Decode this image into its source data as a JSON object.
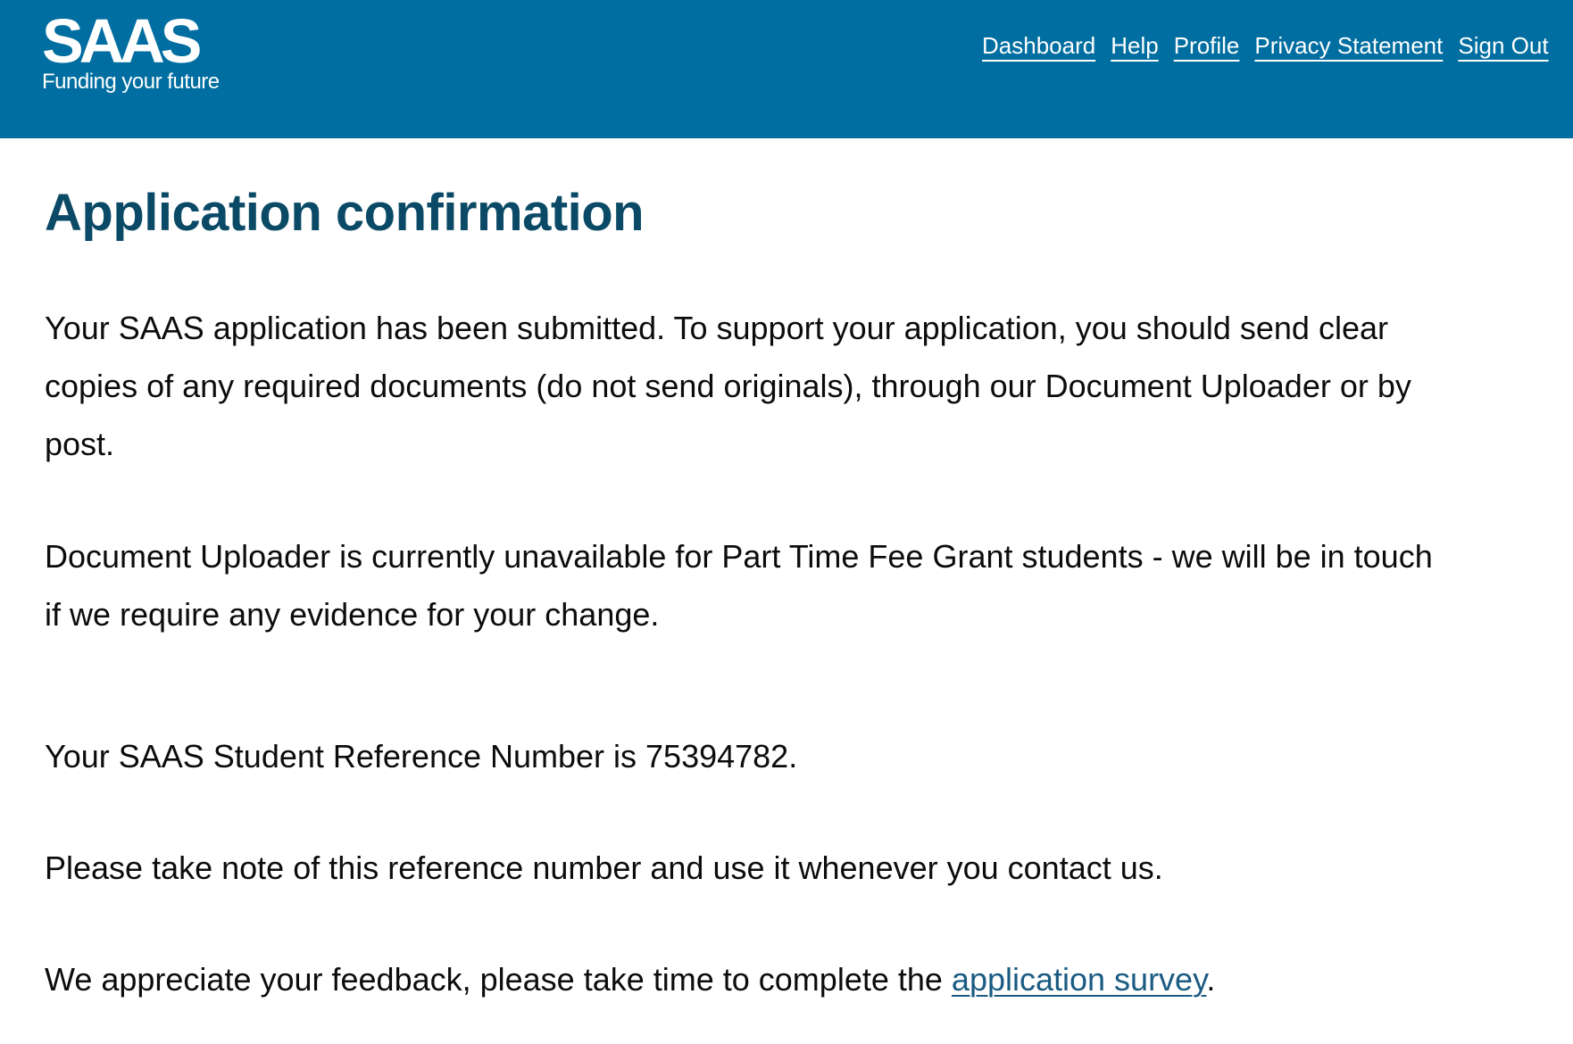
{
  "header": {
    "logo_text": "SAAS",
    "logo_tagline": "Funding your future",
    "nav": {
      "dashboard": "Dashboard",
      "help": "Help",
      "profile": "Profile",
      "privacy": "Privacy Statement",
      "signout": "Sign Out"
    },
    "background_color": "#006ea0"
  },
  "main": {
    "title": "Application confirmation",
    "para1_line1": "Your SAAS application has been submitted. To support your application, you should send clear",
    "para1_line2": "copies of any required documents (do not send originals), through our Document Uploader or by",
    "para1_line3": "post.",
    "para2_line1": "Document Uploader is currently unavailable for Part Time Fee Grant students - we will be in touch",
    "para2_line2": "if we require any evidence for your change.",
    "reference_text": "Your SAAS Student Reference Number is 75394782.",
    "note_text": "Please take note of this reference number and use it whenever you contact us.",
    "feedback_prefix": "We appreciate your feedback, please take time to complete the ",
    "survey_link": "application survey",
    "feedback_suffix": "."
  }
}
